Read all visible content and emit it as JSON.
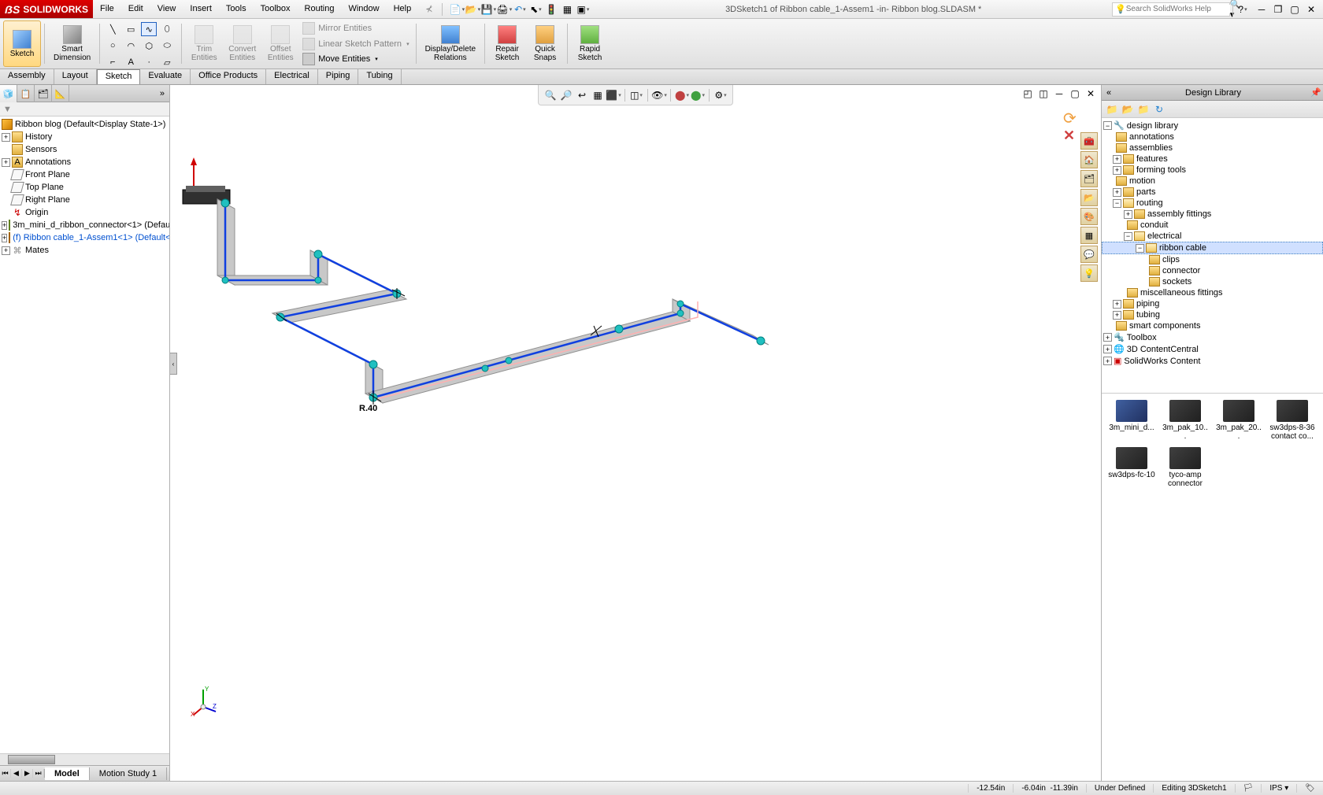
{
  "app": {
    "name": "SOLIDWORKS",
    "title": "3DSketch1 of Ribbon cable_1-Assem1 -in- Ribbon blog.SLDASM *"
  },
  "menus": [
    "File",
    "Edit",
    "View",
    "Insert",
    "Tools",
    "Toolbox",
    "Routing",
    "Window",
    "Help"
  ],
  "search": {
    "placeholder": "Search SolidWorks Help"
  },
  "ribbon": {
    "sketch": "Sketch",
    "smart_dimension": "Smart\nDimension",
    "trim": "Trim\nEntities",
    "convert": "Convert\nEntities",
    "offset": "Offset\nEntities",
    "mirror": "Mirror Entities",
    "pattern": "Linear Sketch Pattern",
    "move": "Move Entities",
    "display_delete": "Display/Delete\nRelations",
    "repair": "Repair\nSketch",
    "quick_snaps": "Quick\nSnaps",
    "rapid": "Rapid\nSketch"
  },
  "tabs": [
    "Assembly",
    "Layout",
    "Sketch",
    "Evaluate",
    "Office Products",
    "Electrical",
    "Piping",
    "Tubing"
  ],
  "active_tab": "Sketch",
  "feature_tree": {
    "root": "Ribbon blog  (Default<Display State-1>)",
    "history": "History",
    "sensors": "Sensors",
    "annotations": "Annotations",
    "front": "Front Plane",
    "top": "Top Plane",
    "right": "Right Plane",
    "origin": "Origin",
    "comp1": "3m_mini_d_ribbon_connector<1> (Default<Display State-1>)",
    "comp2": "(f) Ribbon cable_1-Assem1<1> (Default<Default_Display State-1>)",
    "mates": "Mates"
  },
  "bottom_tabs": {
    "model": "Model",
    "motion": "Motion Study 1"
  },
  "design_library": {
    "title": "Design Library",
    "tree": {
      "root": "design library",
      "annotations": "annotations",
      "assemblies": "assemblies",
      "features": "features",
      "forming": "forming tools",
      "motion": "motion",
      "parts": "parts",
      "routing": "routing",
      "asm_fittings": "assembly fittings",
      "conduit": "conduit",
      "electrical": "electrical",
      "ribbon_cable": "ribbon cable",
      "clips": "clips",
      "connector": "connector",
      "sockets": "sockets",
      "misc_fittings": "miscellaneous fittings",
      "piping": "piping",
      "tubing": "tubing",
      "smart_comp": "smart components",
      "toolbox": "Toolbox",
      "contentcentral": "3D ContentCentral",
      "sw_content": "SolidWorks Content"
    },
    "thumbs": [
      {
        "label": "3m_mini_d..."
      },
      {
        "label": "3m_pak_10..."
      },
      {
        "label": "3m_pak_20..."
      },
      {
        "label": "sw3dps-8-36 contact co..."
      },
      {
        "label": "sw3dps-fc-10"
      },
      {
        "label": "tyco-amp connector"
      }
    ]
  },
  "status": {
    "coord1": "-12.54in",
    "coord2": "-6.04in",
    "coord3": "-11.39in",
    "defined": "Under Defined",
    "editing": "Editing 3DSketch1",
    "units": "IPS"
  },
  "sketch_label": "R.40"
}
